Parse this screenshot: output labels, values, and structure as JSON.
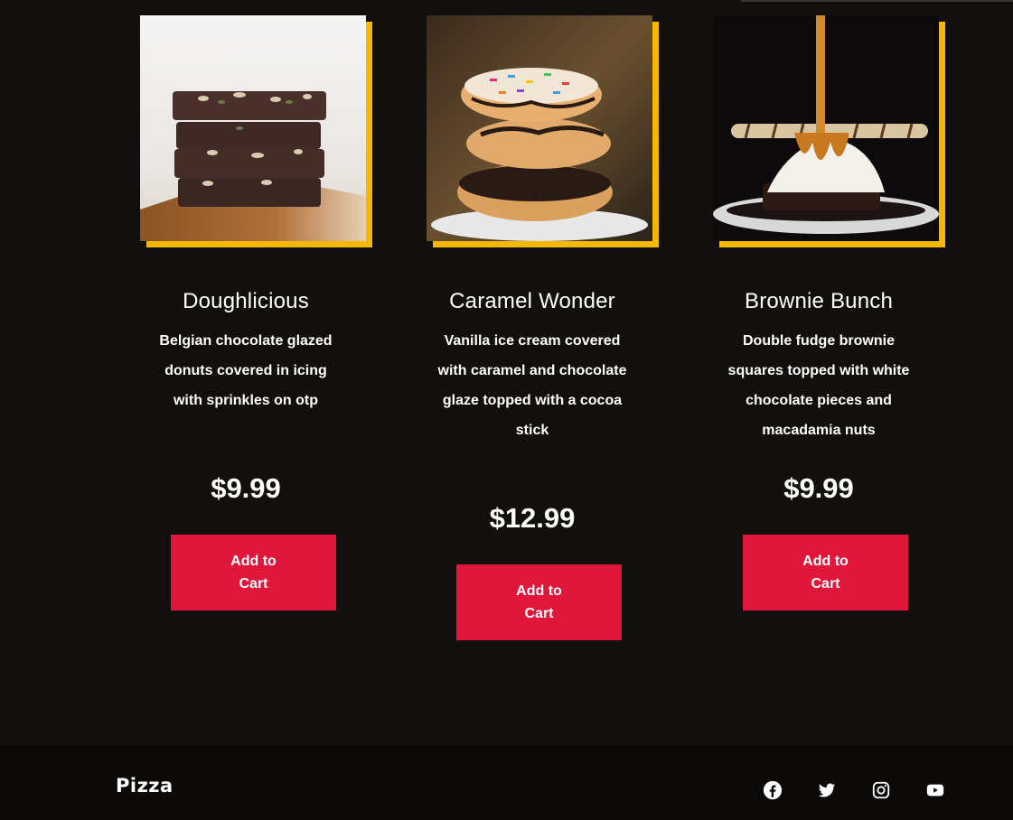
{
  "products": [
    {
      "title": "Doughlicious",
      "description": "Belgian chocolate glazed donuts covered in icing with sprinkles on otp",
      "price": "$9.99",
      "button_label": "Add to Cart"
    },
    {
      "title": "Caramel Wonder",
      "description": "Vanilla ice cream covered with caramel and chocolate glaze topped with a cocoa stick",
      "price": "$12.99",
      "button_label": "Add to Cart"
    },
    {
      "title": "Brownie Bunch",
      "description": "Double fudge brownie squares topped with white chocolate pieces and macadamia nuts",
      "price": "$9.99",
      "button_label": "Add to Cart"
    }
  ],
  "footer": {
    "brand": "Pizza",
    "social": [
      "facebook-icon",
      "twitter-icon",
      "instagram-icon",
      "youtube-icon"
    ]
  },
  "colors": {
    "background": "#140f0f",
    "accent": "#f5b800",
    "button": "#e0173a",
    "footer": "#0c0909"
  }
}
